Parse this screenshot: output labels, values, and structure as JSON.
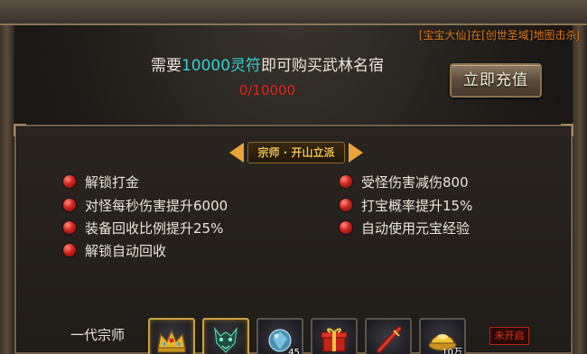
{
  "broadcast": "[宝宝大仙]在[创世圣域]地图击杀J",
  "header": {
    "need_prefix": "需要",
    "need_amount": "10000灵符",
    "need_suffix": "即可购买武林名宿",
    "progress": "0/10000",
    "recharge_label": "立即充值"
  },
  "panel": {
    "title": "宗师 · 开山立派",
    "perks_left": [
      "解锁打金",
      "对怪每秒伤害提升6000",
      "装备回收比例提升25%",
      "解锁自动回收"
    ],
    "perks_right": [
      "受怪伤害减伤800",
      "打宝概率提升15%",
      "自动使用元宝经验"
    ],
    "tier_label": "一代宗师",
    "rewards": [
      {
        "icon": "crown-icon",
        "count": ""
      },
      {
        "icon": "demon-mask-icon",
        "count": ""
      },
      {
        "icon": "gem-icon",
        "count": "45"
      },
      {
        "icon": "gift-box-icon",
        "count": ""
      },
      {
        "icon": "flute-icon",
        "count": ""
      },
      {
        "icon": "gold-ingot-icon",
        "count": "10万"
      }
    ],
    "status": "未开启"
  },
  "colors": {
    "accent_cyan": "#34d0d6",
    "progress_red": "#e3251d",
    "broadcast_orange": "#e07a1d",
    "title_gold": "#f1c353"
  }
}
